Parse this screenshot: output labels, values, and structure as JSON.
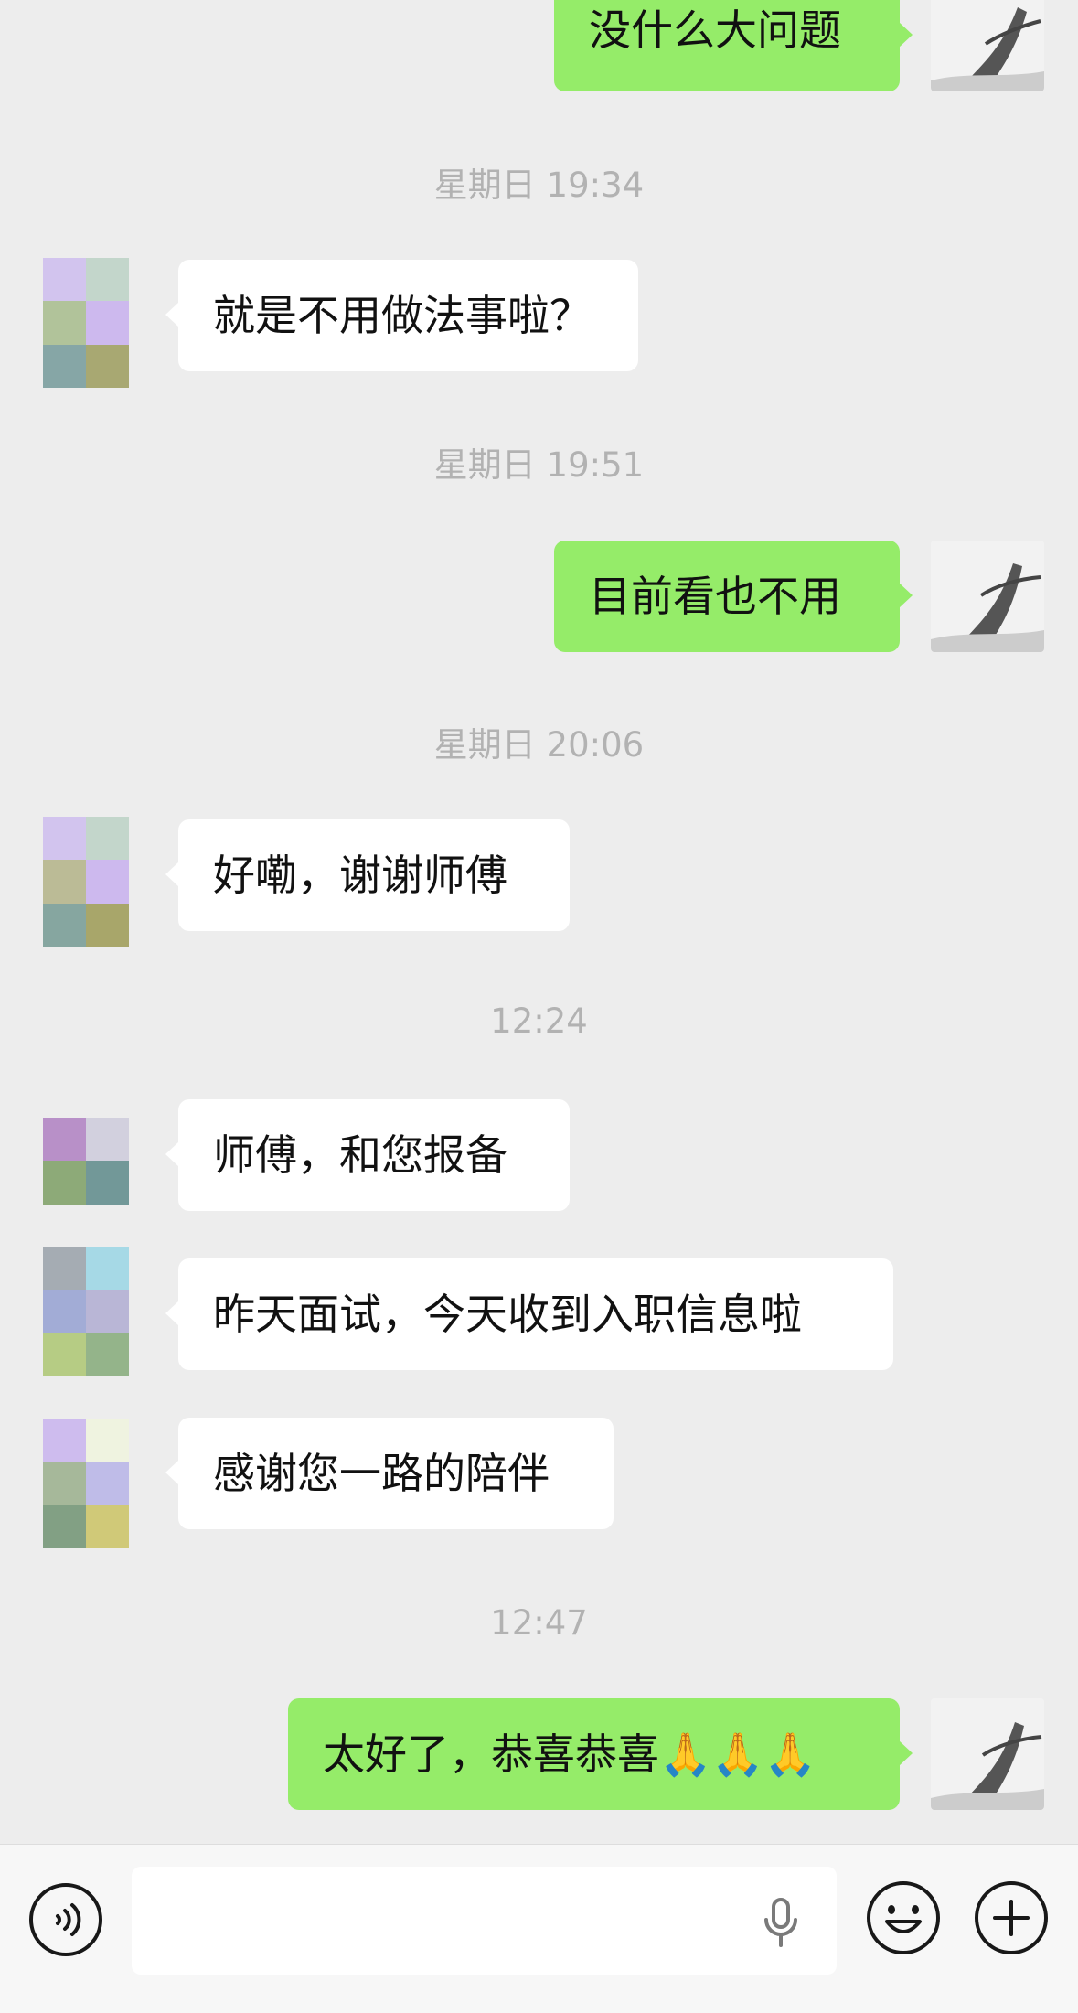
{
  "messages": [
    {
      "type": "out",
      "text": "没什么大问题"
    },
    {
      "type": "time",
      "text": "星期日 19:34"
    },
    {
      "type": "in",
      "text": "就是不用做法事啦？"
    },
    {
      "type": "time",
      "text": "星期日 19:51"
    },
    {
      "type": "out",
      "text": "目前看也不用"
    },
    {
      "type": "time",
      "text": "星期日 20:06"
    },
    {
      "type": "in",
      "text": "好嘞，谢谢师傅"
    },
    {
      "type": "time",
      "text": "12:24"
    },
    {
      "type": "in",
      "text": "师傅，和您报备"
    },
    {
      "type": "in",
      "text": "昨天面试，今天收到入职信息啦"
    },
    {
      "type": "in",
      "text": "感谢您一路的陪伴"
    },
    {
      "type": "time",
      "text": "12:47"
    },
    {
      "type": "out",
      "text": "太好了，恭喜恭喜🙏🙏🙏"
    }
  ],
  "icons": {
    "voice": "voice-icon",
    "mic": "microphone-icon",
    "emoji": "emoji-icon",
    "plus": "plus-icon"
  },
  "colors": {
    "background": "#EDEDED",
    "incoming_bubble": "#FFFFFF",
    "outgoing_bubble": "#95EC69",
    "timestamp": "#B2B2B2"
  }
}
